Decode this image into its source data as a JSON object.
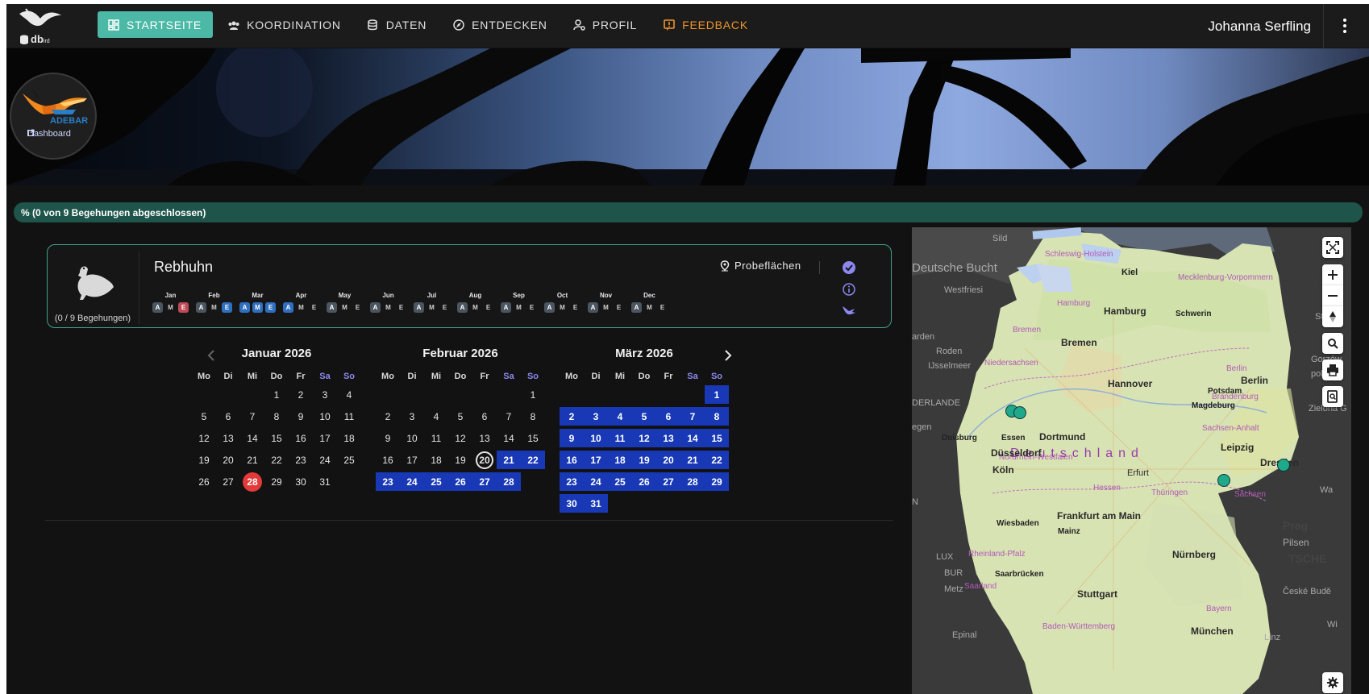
{
  "app": {
    "logo_text": "dbird",
    "logo_sub": "ird"
  },
  "nav": [
    {
      "label": "STARTSEITE",
      "icon": "dashboard-icon",
      "active": true
    },
    {
      "label": "KOORDINATION",
      "icon": "group-icon"
    },
    {
      "label": "DATEN",
      "icon": "database-icon"
    },
    {
      "label": "ENTDECKEN",
      "icon": "compass-icon"
    },
    {
      "label": "PROFIL",
      "icon": "user-settings-icon"
    },
    {
      "label": "FEEDBACK",
      "icon": "feedback-icon",
      "color": "#f0932b"
    }
  ],
  "user": {
    "name": "Johanna Serfling"
  },
  "banner": {
    "badge_title": "ADEBAR",
    "badge_link": "Dashboard"
  },
  "progress": {
    "text": "%  (0 von 9 Begehungen abgeschlossen)"
  },
  "species": {
    "name": "Rebhuhn",
    "count": "(0 / 9 Begehungen)",
    "probe_label": "Probeflächen",
    "months": [
      {
        "label": "Jan",
        "chips": [
          "A",
          "M",
          "E"
        ]
      },
      {
        "label": "Feb",
        "chips": [
          "A",
          "M",
          "E"
        ]
      },
      {
        "label": "Mar",
        "chips": [
          "A",
          "M",
          "E"
        ]
      },
      {
        "label": "Apr",
        "chips": [
          "A",
          "M",
          "E"
        ]
      },
      {
        "label": "May",
        "chips": [
          "A",
          "M",
          "E"
        ]
      },
      {
        "label": "Jun",
        "chips": [
          "A",
          "M",
          "E"
        ]
      },
      {
        "label": "Jul",
        "chips": [
          "A",
          "M",
          "E"
        ]
      },
      {
        "label": "Aug",
        "chips": [
          "A",
          "M",
          "E"
        ]
      },
      {
        "label": "Sep",
        "chips": [
          "A",
          "M",
          "E"
        ]
      },
      {
        "label": "Oct",
        "chips": [
          "A",
          "M",
          "E"
        ]
      },
      {
        "label": "Nov",
        "chips": [
          "A",
          "M",
          "E"
        ]
      },
      {
        "label": "Dec",
        "chips": [
          "A",
          "M",
          "E"
        ]
      }
    ]
  },
  "calendar": {
    "weekdays": [
      "Mo",
      "Di",
      "Mi",
      "Do",
      "Fr",
      "Sa",
      "So"
    ],
    "months": [
      {
        "title": "Januar 2026",
        "offset": 3,
        "days": 31,
        "selected_from": null,
        "today": null,
        "highlight": 28
      },
      {
        "title": "Februar 2026",
        "offset": 6,
        "days": 28,
        "selected_from": 21,
        "today": 20,
        "highlight": null
      },
      {
        "title": "März 2026",
        "offset": 6,
        "days": 31,
        "selected_from": 1,
        "today": null,
        "highlight": null
      }
    ]
  },
  "map": {
    "country_label": "Deutschland",
    "cities": [
      {
        "name": "Hamburg",
        "kind": "city"
      },
      {
        "name": "Bremen",
        "kind": "city"
      },
      {
        "name": "Hannover",
        "kind": "city"
      },
      {
        "name": "Berlin",
        "kind": "city"
      },
      {
        "name": "Dortmund",
        "kind": "city"
      },
      {
        "name": "Düsseldorf",
        "kind": "city"
      },
      {
        "name": "Köln",
        "kind": "city"
      },
      {
        "name": "Leipzig",
        "kind": "city"
      },
      {
        "name": "Dresden",
        "kind": "city"
      },
      {
        "name": "Erfurt",
        "kind": "city"
      },
      {
        "name": "Frankfurt am Main",
        "kind": "city"
      },
      {
        "name": "Nürnberg",
        "kind": "city"
      },
      {
        "name": "Stuttgart",
        "kind": "city"
      },
      {
        "name": "München",
        "kind": "city"
      },
      {
        "name": "Kiel",
        "kind": "city"
      },
      {
        "name": "Schwerin",
        "kind": "city"
      },
      {
        "name": "Potsdam",
        "kind": "city"
      },
      {
        "name": "Magdeburg",
        "kind": "city"
      },
      {
        "name": "Duisburg",
        "kind": "city"
      },
      {
        "name": "Essen",
        "kind": "city"
      },
      {
        "name": "Wiesbaden",
        "kind": "city"
      },
      {
        "name": "Mainz",
        "kind": "city"
      },
      {
        "name": "Saarbrücken",
        "kind": "city"
      },
      {
        "name": "Prag",
        "kind": "big"
      },
      {
        "name": "Pilsen",
        "kind": "outer"
      },
      {
        "name": "Linz",
        "kind": "outer"
      }
    ],
    "regions": [
      "Schleswig-Holstein",
      "Mecklenburg-Vorpommern",
      "Hamburg",
      "Bremen",
      "Niedersachsen",
      "Berlin",
      "Brandenburg",
      "Sachsen-Anhalt",
      "Nordrhein-Westfalen",
      "Hessen",
      "Thüringen",
      "Sachsen",
      "Rheinland-Pfalz",
      "Saarland",
      "Bayern",
      "Baden-Württemberg"
    ]
  }
}
